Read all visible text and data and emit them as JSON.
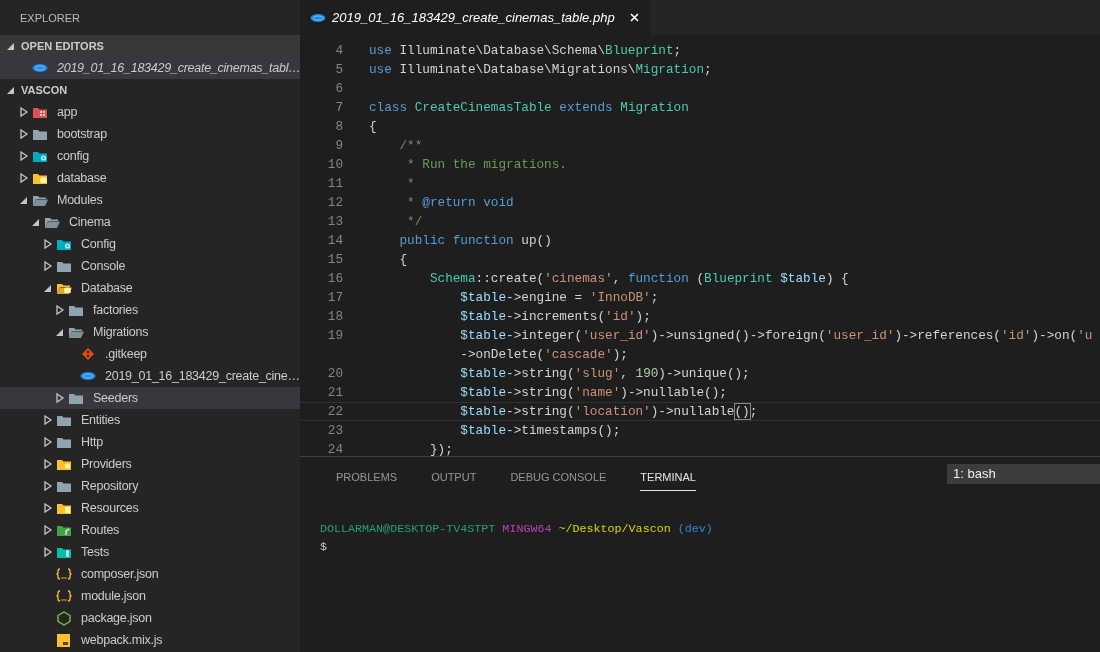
{
  "sidebar": {
    "title": "EXPLORER",
    "open_editors": {
      "title": "OPEN EDITORS",
      "expanded": true,
      "items": [
        {
          "label": "2019_01_16_183429_create_cinemas_tabl…",
          "kind": "php",
          "selected": true
        }
      ]
    },
    "project": {
      "title": "VASCON",
      "expanded": true,
      "tree": [
        {
          "label": "app",
          "kind": "appfolder",
          "expanded": false,
          "selected": false
        },
        {
          "label": "bootstrap",
          "kind": "folder",
          "expanded": false,
          "selected": false
        },
        {
          "label": "config",
          "kind": "configfolder",
          "expanded": false,
          "selected": false
        },
        {
          "label": "database",
          "kind": "dbfolder",
          "expanded": false,
          "selected": false
        },
        {
          "label": "Modules",
          "kind": "folder",
          "expanded": true,
          "selected": false,
          "children": [
            {
              "label": "Cinema",
              "kind": "folder",
              "expanded": true,
              "selected": false,
              "children": [
                {
                  "label": "Config",
                  "kind": "configfolder",
                  "expanded": false,
                  "selected": false
                },
                {
                  "label": "Console",
                  "kind": "folder",
                  "expanded": false,
                  "selected": false
                },
                {
                  "label": "Database",
                  "kind": "dbfolder",
                  "expanded": true,
                  "selected": false,
                  "children": [
                    {
                      "label": "factories",
                      "kind": "folder",
                      "expanded": false,
                      "selected": false
                    },
                    {
                      "label": "Migrations",
                      "kind": "folder",
                      "expanded": true,
                      "selected": false,
                      "children": [
                        {
                          "label": ".gitkeep",
                          "kind": "git",
                          "selected": false
                        },
                        {
                          "label": "2019_01_16_183429_create_cine…",
                          "kind": "php",
                          "selected": false
                        }
                      ]
                    },
                    {
                      "label": "Seeders",
                      "kind": "folder",
                      "expanded": false,
                      "selected": true
                    }
                  ]
                },
                {
                  "label": "Entities",
                  "kind": "folder",
                  "expanded": false,
                  "selected": false
                },
                {
                  "label": "Http",
                  "kind": "folder",
                  "expanded": false,
                  "selected": false
                },
                {
                  "label": "Providers",
                  "kind": "providersfolder",
                  "expanded": false,
                  "selected": false
                },
                {
                  "label": "Repository",
                  "kind": "folder",
                  "expanded": false,
                  "selected": false
                },
                {
                  "label": "Resources",
                  "kind": "resourcesfolder",
                  "expanded": false,
                  "selected": false
                },
                {
                  "label": "Routes",
                  "kind": "routesfolder",
                  "expanded": false,
                  "selected": false
                },
                {
                  "label": "Tests",
                  "kind": "testsfolder",
                  "expanded": false,
                  "selected": false
                },
                {
                  "label": "composer.json",
                  "kind": "json",
                  "selected": false
                },
                {
                  "label": "module.json",
                  "kind": "json",
                  "selected": false
                },
                {
                  "label": "package.json",
                  "kind": "node",
                  "selected": false
                },
                {
                  "label": "webpack.mix.js",
                  "kind": "js",
                  "selected": false
                }
              ]
            }
          ]
        }
      ]
    }
  },
  "editor": {
    "tabs": [
      {
        "label": "2019_01_16_183429_create_cinemas_table.php",
        "kind": "php",
        "selected": true
      }
    ],
    "lines": [
      {
        "number": "4",
        "tokens": [
          {
            "kind": "kw",
            "text": "use"
          },
          {
            "kind": "plain",
            "text": " Illuminate\\Database\\Schema\\"
          },
          {
            "kind": "cls",
            "text": "Blueprint"
          },
          {
            "kind": "plain",
            "text": ";"
          }
        ]
      },
      {
        "number": "5",
        "tokens": [
          {
            "kind": "kw",
            "text": "use"
          },
          {
            "kind": "plain",
            "text": " Illuminate\\Database\\Migrations\\"
          },
          {
            "kind": "cls",
            "text": "Migration"
          },
          {
            "kind": "plain",
            "text": ";"
          }
        ]
      },
      {
        "number": "6"
      },
      {
        "number": "7",
        "tokens": [
          {
            "kind": "kw",
            "text": "class "
          },
          {
            "kind": "cls",
            "text": "CreateCinemasTable "
          },
          {
            "kind": "kw",
            "text": "extends "
          },
          {
            "kind": "cls",
            "text": "Migration"
          }
        ]
      },
      {
        "number": "8",
        "tokens": [
          {
            "kind": "plain",
            "text": "{"
          }
        ]
      },
      {
        "number": "9",
        "tokens": [
          {
            "kind": "cmt",
            "text": "    /**"
          }
        ]
      },
      {
        "number": "10",
        "tokens": [
          {
            "kind": "cmt",
            "text": "     * Run the migrations."
          }
        ]
      },
      {
        "number": "11",
        "tokens": [
          {
            "kind": "cmt",
            "text": "     *"
          }
        ]
      },
      {
        "number": "12",
        "tokens": [
          {
            "kind": "cmt",
            "text": "     * "
          },
          {
            "kind": "kw",
            "text": "@return void"
          }
        ]
      },
      {
        "number": "13",
        "tokens": [
          {
            "kind": "cmt",
            "text": "     */"
          }
        ]
      },
      {
        "number": "14",
        "tokens": [
          {
            "kind": "kw",
            "text": "    public function"
          },
          {
            "kind": "plain",
            "text": " up()"
          }
        ]
      },
      {
        "number": "15",
        "tokens": [
          {
            "kind": "plain",
            "text": "    {"
          }
        ]
      },
      {
        "number": "16",
        "tokens": [
          {
            "kind": "cls",
            "text": "        Schema"
          },
          {
            "kind": "plain",
            "text": "::create("
          },
          {
            "kind": "str",
            "text": "'cinemas'"
          },
          {
            "kind": "plain",
            "text": ", "
          },
          {
            "kind": "kw",
            "text": "function"
          },
          {
            "kind": "plain",
            "text": " ("
          },
          {
            "kind": "cls",
            "text": "Blueprint "
          },
          {
            "kind": "var",
            "text": "$table"
          },
          {
            "kind": "plain",
            "text": ") {"
          }
        ]
      },
      {
        "number": "17",
        "tokens": [
          {
            "kind": "var",
            "text": "            $table"
          },
          {
            "kind": "plain",
            "text": "->engine = "
          },
          {
            "kind": "str",
            "text": "'InnoDB'"
          },
          {
            "kind": "plain",
            "text": ";"
          }
        ]
      },
      {
        "number": "18",
        "tokens": [
          {
            "kind": "var",
            "text": "            $table"
          },
          {
            "kind": "plain",
            "text": "->increments("
          },
          {
            "kind": "str",
            "text": "'id'"
          },
          {
            "kind": "plain",
            "text": ");"
          }
        ]
      },
      {
        "number": "19",
        "tokens": [
          {
            "kind": "var",
            "text": "            $table"
          },
          {
            "kind": "plain",
            "text": "->integer("
          },
          {
            "kind": "str",
            "text": "'user_id'"
          },
          {
            "kind": "plain",
            "text": ")->unsigned()->foreign("
          },
          {
            "kind": "str",
            "text": "'user_id'"
          },
          {
            "kind": "plain",
            "text": ")->references("
          },
          {
            "kind": "str",
            "text": "'id'"
          },
          {
            "kind": "plain",
            "text": ")->on("
          },
          {
            "kind": "str",
            "text": "'u"
          }
        ]
      },
      {
        "tokens": [
          {
            "kind": "plain",
            "text": "            ->onDelete("
          },
          {
            "kind": "str",
            "text": "'cascade'"
          },
          {
            "kind": "plain",
            "text": ");"
          }
        ]
      },
      {
        "number": "20",
        "tokens": [
          {
            "kind": "var",
            "text": "            $table"
          },
          {
            "kind": "plain",
            "text": "->string("
          },
          {
            "kind": "str",
            "text": "'slug'"
          },
          {
            "kind": "plain",
            "text": ", "
          },
          {
            "kind": "num",
            "text": "190"
          },
          {
            "kind": "plain",
            "text": ")->unique();"
          }
        ]
      },
      {
        "number": "21",
        "tokens": [
          {
            "kind": "var",
            "text": "            $table"
          },
          {
            "kind": "plain",
            "text": "->string("
          },
          {
            "kind": "str",
            "text": "'name'"
          },
          {
            "kind": "plain",
            "text": ")->nullable();"
          }
        ]
      },
      {
        "number": "22",
        "current": true,
        "tokens": [
          {
            "kind": "var",
            "text": "            $table"
          },
          {
            "kind": "plain",
            "text": "->string("
          },
          {
            "kind": "str",
            "text": "'location'"
          },
          {
            "kind": "plain",
            "text": ")->nullable"
          },
          {
            "kind": "match",
            "text": "()"
          },
          {
            "kind": "plain",
            "text": ";"
          }
        ]
      },
      {
        "number": "23",
        "tokens": [
          {
            "kind": "var",
            "text": "            $table"
          },
          {
            "kind": "plain",
            "text": "->timestamps();"
          }
        ]
      },
      {
        "number": "24",
        "tokens": [
          {
            "kind": "plain",
            "text": "        });"
          }
        ]
      }
    ]
  },
  "panel": {
    "tabs": [
      {
        "label": "PROBLEMS",
        "selected": false
      },
      {
        "label": "OUTPUT",
        "selected": false
      },
      {
        "label": "DEBUG CONSOLE",
        "selected": false
      },
      {
        "label": "TERMINAL",
        "selected": true
      }
    ],
    "terminal_selector": "1: bash",
    "terminal_lines": [
      [
        {
          "kind": "green",
          "text": "DOLLARMAN@DESKTOP-TV4STPT "
        },
        {
          "kind": "magenta",
          "text": "MINGW64 "
        },
        {
          "kind": "yellow",
          "text": "~/Desktop/Vascon "
        },
        {
          "kind": "blue",
          "text": "(dev)"
        }
      ],
      [
        {
          "kind": "plain",
          "text": "$"
        }
      ]
    ]
  }
}
